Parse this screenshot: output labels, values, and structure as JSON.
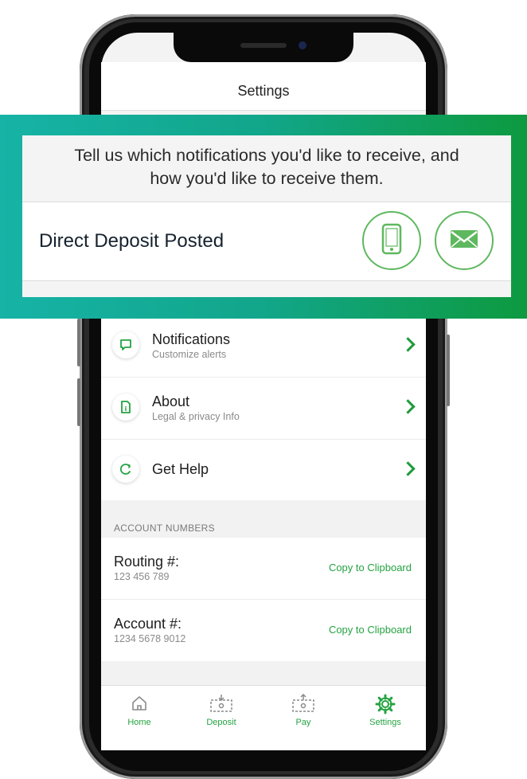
{
  "header": {
    "title": "Settings"
  },
  "callout": {
    "message_line1": "Tell us which notifications you'd like to receive, and",
    "message_line2": "how you'd like to receive them.",
    "preference_label": "Direct Deposit Posted",
    "channels": [
      {
        "icon": "phone-icon"
      },
      {
        "icon": "email-icon"
      }
    ]
  },
  "menu": {
    "items": [
      {
        "title": "Notifications",
        "subtitle": "Customize alerts",
        "icon": "chat-bubble-icon"
      },
      {
        "title": "About",
        "subtitle": "Legal & privacy Info",
        "icon": "document-info-icon"
      },
      {
        "title": "Get Help",
        "subtitle": "",
        "icon": "help-bubble-icon"
      }
    ]
  },
  "account_numbers": {
    "section_header": "ACCOUNT NUMBERS",
    "rows": [
      {
        "label": "Routing #:",
        "value": "123 456 789",
        "action": "Copy to Clipboard"
      },
      {
        "label": "Account #:",
        "value": "1234 5678 9012",
        "action": "Copy to Clipboard"
      }
    ]
  },
  "tabs": [
    {
      "label": "Home",
      "icon": "home-icon"
    },
    {
      "label": "Deposit",
      "icon": "deposit-icon"
    },
    {
      "label": "Pay",
      "icon": "pay-icon"
    },
    {
      "label": "Settings",
      "icon": "gear-icon"
    }
  ],
  "colors": {
    "accent_green": "#24a341",
    "gradient_start": "#16b3a6",
    "gradient_end": "#0d9a3f"
  }
}
